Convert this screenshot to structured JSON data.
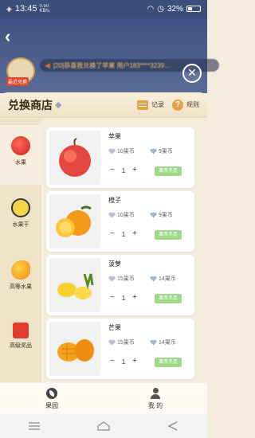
{
  "status": {
    "time": "13:45",
    "net_speed_top": "0.50",
    "net_speed_bottom": "KB/s",
    "battery": "32%"
  },
  "marquee": {
    "badge_label": "最近兑换",
    "text": "[20]恭喜我兑换了苹果 用户183****3239..."
  },
  "shop": {
    "title": "兑换商店",
    "record_label": "记录",
    "rule_label": "规则"
  },
  "categories": [
    {
      "label": "水果"
    },
    {
      "label": "水果干"
    },
    {
      "label": "高等水果"
    },
    {
      "label": "高级奖品"
    }
  ],
  "products": [
    {
      "name": "苹果",
      "price_coin": "10果币",
      "price_diamond": "9果币",
      "qty": "1",
      "button": "果币不足"
    },
    {
      "name": "橙子",
      "price_coin": "10果币",
      "price_diamond": "9果币",
      "qty": "1",
      "button": "果币不足"
    },
    {
      "name": "菠萝",
      "price_coin": "15果币",
      "price_diamond": "14果币",
      "qty": "1",
      "button": "果币不足"
    },
    {
      "name": "芒果",
      "price_coin": "15果币",
      "price_diamond": "14果币",
      "qty": "1",
      "button": "果币不足"
    }
  ],
  "bottom_nav": [
    {
      "label": "果园"
    },
    {
      "label": "我 的"
    }
  ],
  "colors": {
    "header_blue": "#3d5283",
    "panel_bg": "#f4ecdc",
    "buy_green": "#9fd88c"
  }
}
